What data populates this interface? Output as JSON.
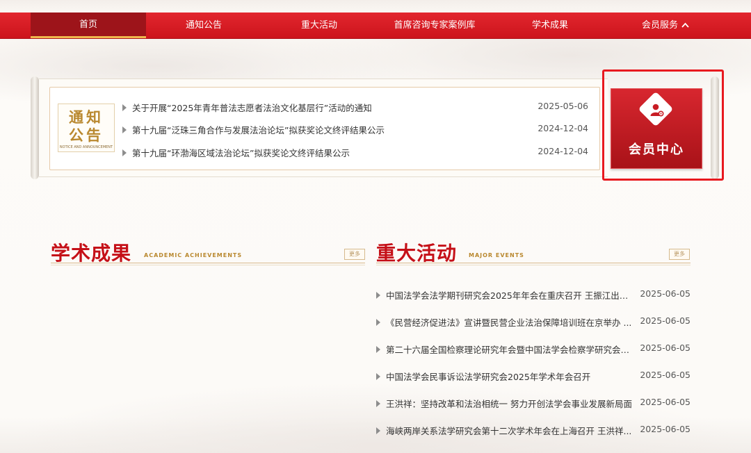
{
  "nav": {
    "items": [
      {
        "label": "首页",
        "active": true
      },
      {
        "label": "通知公告"
      },
      {
        "label": "重大活动"
      },
      {
        "label": "首席咨询专家案例库"
      },
      {
        "label": "学术成果"
      },
      {
        "label": "会员服务",
        "icon": "chevron-up-icon"
      }
    ]
  },
  "notice": {
    "stamp_line1": "通知",
    "stamp_line2": "公告",
    "stamp_sub": "NOTICE AND ANNOUNCEMENT",
    "items": [
      {
        "title": "关于开展“2025年青年普法志愿者法治文化基层行”活动的通知",
        "date": "2025-05-06"
      },
      {
        "title": "第十九届“泛珠三角合作与发展法治论坛”拟获奖论文终评结果公示",
        "date": "2024-12-04"
      },
      {
        "title": "第十九届“环渤海区域法治论坛”拟获奖论文终评结果公示",
        "date": "2024-12-04"
      }
    ]
  },
  "member": {
    "label": "会员中心",
    "icon": "member-user-gear-icon",
    "highlight_color": "#e8191f"
  },
  "academic": {
    "title": "学术成果",
    "subtitle": "ACADEMIC ACHIEVEMENTS",
    "more": "更多",
    "items": []
  },
  "events": {
    "title": "重大活动",
    "subtitle": "MAJOR EVENTS",
    "more": "更多",
    "items": [
      {
        "title": "中国法学会法学期刊研究会2025年年会在重庆召开 王振江出席...",
        "date": "2025-06-05"
      },
      {
        "title": "《民营经济促进法》宣讲暨民营企业法治保障培训班在京举办 ...",
        "date": "2025-06-05"
      },
      {
        "title": "第二十六届全国检察理论研究年会暨中国法学会检察学研究会年...",
        "date": "2025-06-05"
      },
      {
        "title": "中国法学会民事诉讼法学研究会2025年学术年会召开",
        "date": "2025-06-05"
      },
      {
        "title": "王洪祥：坚持改革和法治相统一 努力开创法学会事业发展新局面",
        "date": "2025-06-05"
      },
      {
        "title": "海峡两岸关系法学研究会第十二次学术年会在上海召开 王洪祥...",
        "date": "2025-06-05"
      }
    ]
  },
  "colors": {
    "brand_red": "#d51f27",
    "gold": "#b9882f"
  }
}
